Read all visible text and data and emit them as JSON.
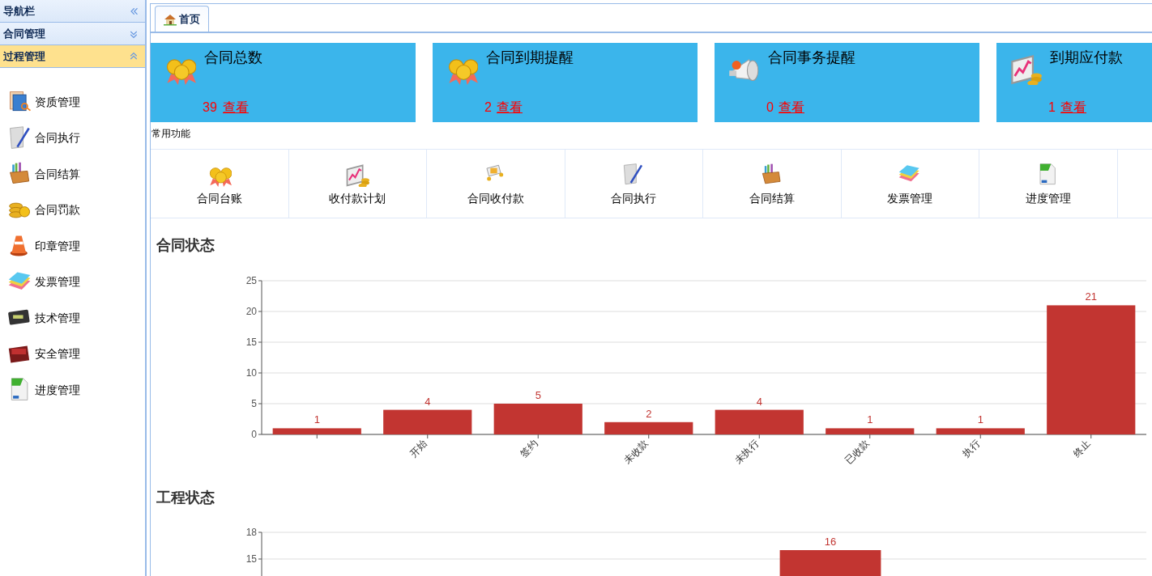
{
  "sidebar": {
    "title": "导航栏",
    "sections": [
      {
        "label": "合同管理",
        "selected": false,
        "expanded": false
      },
      {
        "label": "过程管理",
        "selected": true,
        "expanded": true,
        "items": [
          "资质管理",
          "合同执行",
          "合同结算",
          "合同罚款",
          "印章管理",
          "发票管理",
          "技术管理",
          "安全管理",
          "进度管理"
        ]
      }
    ]
  },
  "tabs": [
    {
      "label": "首页",
      "selected": true
    }
  ],
  "stat_cards": [
    {
      "title": "合同总数",
      "count": "39",
      "link": "查看"
    },
    {
      "title": "合同到期提醒",
      "count": "2",
      "link": "查看"
    },
    {
      "title": "合同事务提醒",
      "count": "0",
      "link": "查看"
    },
    {
      "title": "到期应付款",
      "count": "1",
      "link": "查看"
    }
  ],
  "shortcuts": {
    "title": "常用功能",
    "items": [
      "合同台账",
      "收付款计划",
      "合同收付款",
      "合同执行",
      "合同结算",
      "发票管理",
      "进度管理"
    ]
  },
  "charts": [
    {
      "chart_data": {
        "type": "bar",
        "title": "合同状态",
        "categories": [
          null,
          "开始",
          "签约",
          "未收款",
          "未执行",
          "已收款",
          "执行",
          "终止"
        ],
        "series": [
          {
            "color": "#c23531",
            "values": [
              1,
              4,
              5,
              2,
              4,
              1,
              1,
              21
            ]
          }
        ],
        "ylim": [
          0,
          25
        ],
        "yticks": [
          0,
          5,
          10,
          15,
          20,
          25
        ],
        "grid": true,
        "data_labels": true
      }
    },
    {
      "chart_data": {
        "type": "bar",
        "title": "工程状态",
        "series": [
          {
            "color": "#c23531",
            "values": [
              null,
              null,
              null,
              null,
              16,
              null,
              null
            ]
          }
        ],
        "ylim": [
          0,
          18
        ],
        "yticks": [
          15,
          18
        ],
        "grid": true,
        "data_labels": true
      }
    }
  ]
}
